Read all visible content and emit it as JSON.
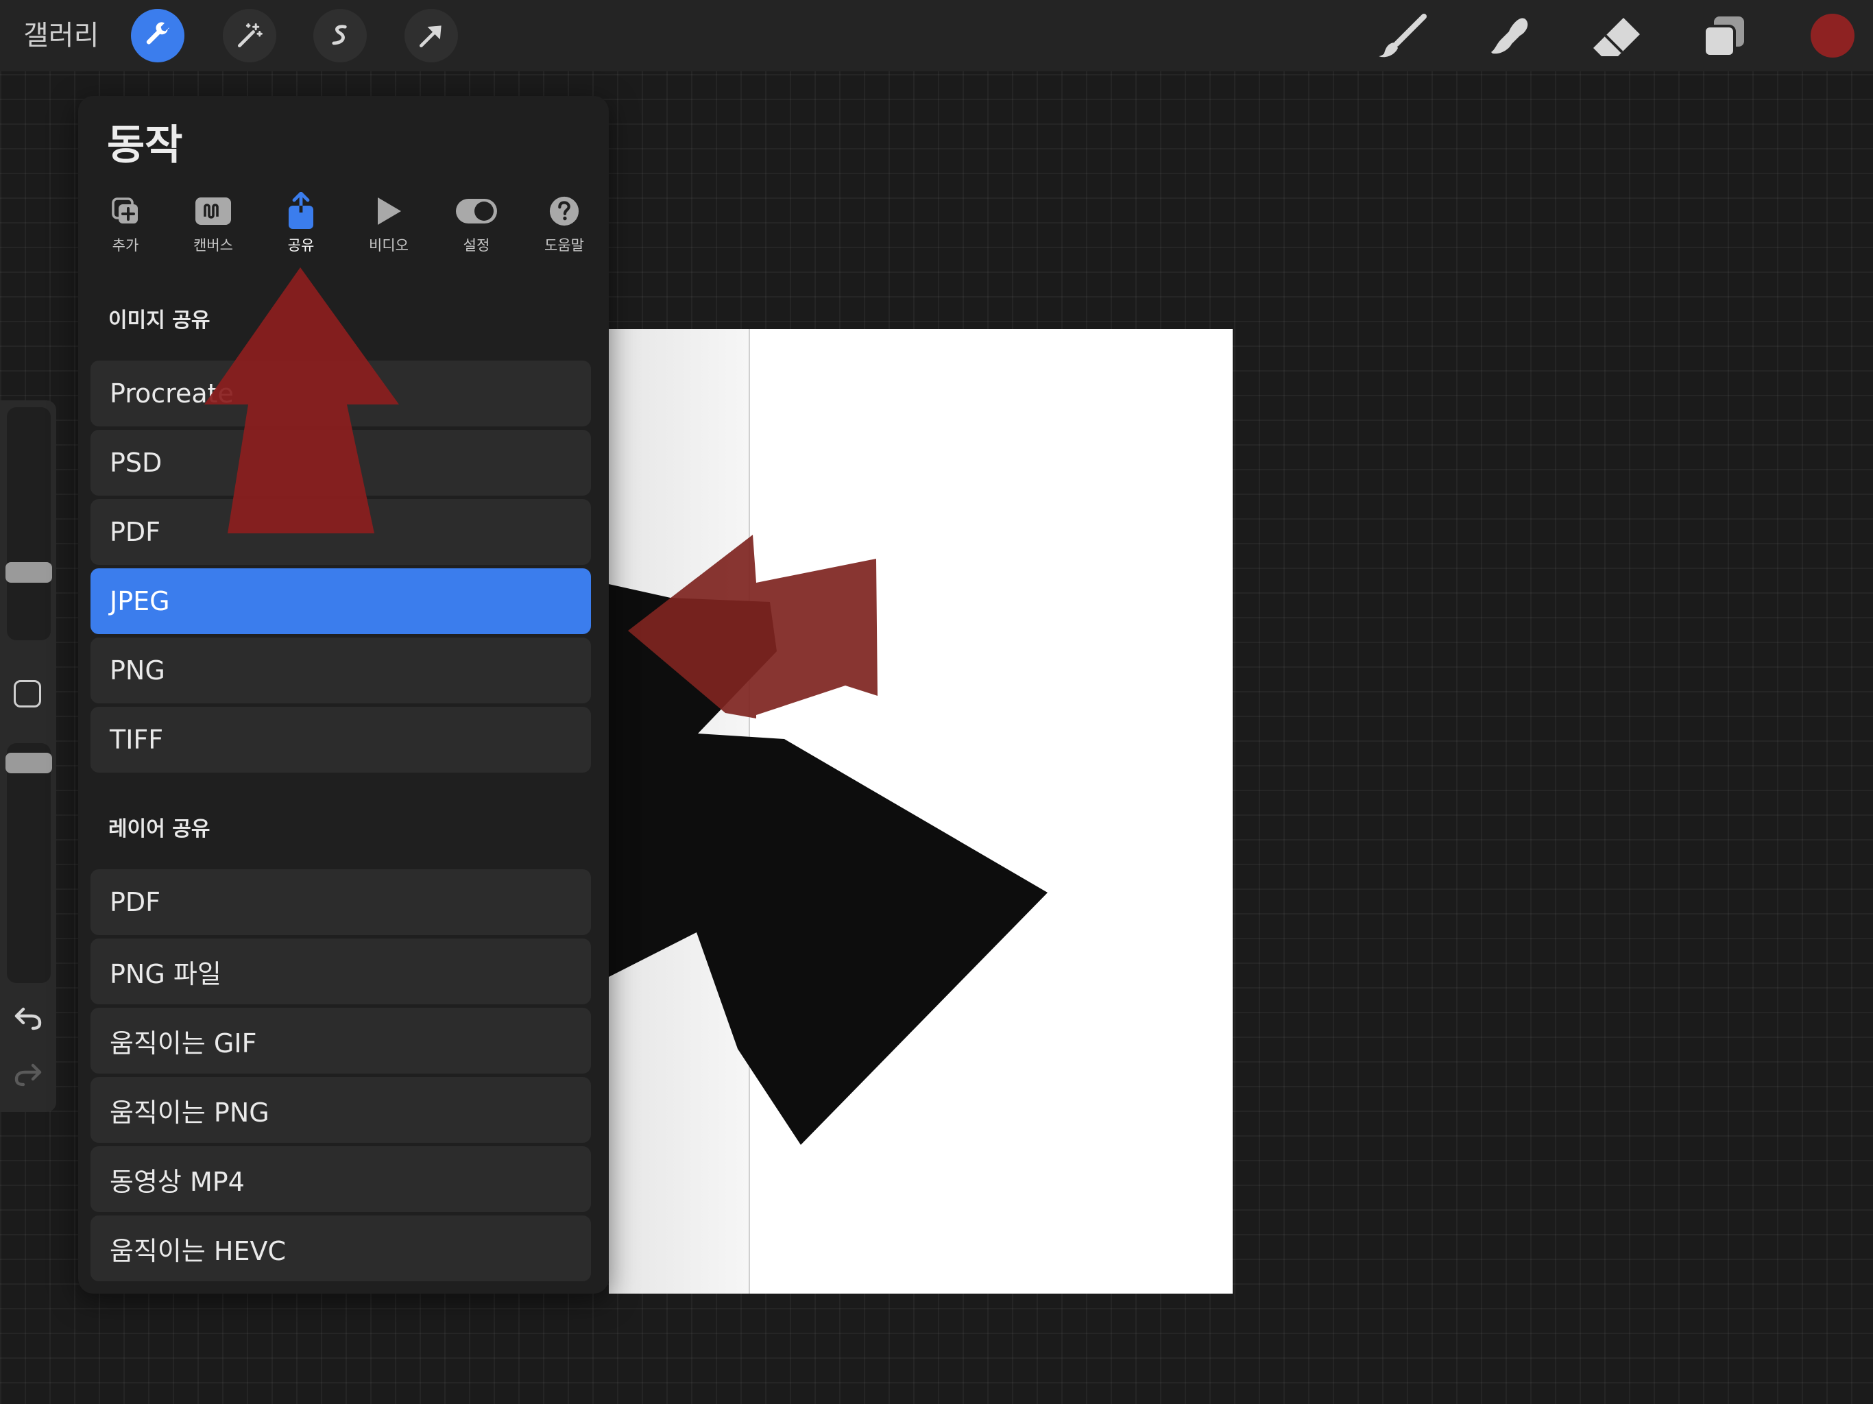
{
  "topbar": {
    "gallery_label": "갤러리",
    "left_tools": [
      "wrench-icon",
      "magic-wand-icon",
      "selection-s-icon",
      "move-arrow-icon"
    ],
    "right_tools": [
      "brush-icon",
      "smudge-icon",
      "eraser-icon",
      "layers-icon"
    ],
    "color_swatch": "#8e2222",
    "accent": "#3b7ded"
  },
  "panel": {
    "title": "동작",
    "tabs": [
      {
        "label": "추가",
        "icon": "add-icon"
      },
      {
        "label": "캔버스",
        "icon": "canvas-icon"
      },
      {
        "label": "공유",
        "icon": "share-icon",
        "active": true
      },
      {
        "label": "비디오",
        "icon": "play-icon"
      },
      {
        "label": "설정",
        "icon": "toggle-icon"
      },
      {
        "label": "도움말",
        "icon": "help-icon"
      }
    ],
    "image_share": {
      "heading": "이미지 공유",
      "items": [
        "Procreate",
        "PSD",
        "PDF",
        "JPEG",
        "PNG",
        "TIFF"
      ],
      "selected": "JPEG"
    },
    "layer_share": {
      "heading": "레이어 공유",
      "items": [
        "PDF",
        "PNG 파일",
        "움직이는 GIF",
        "움직이는 PNG",
        "동영상 MP4",
        "움직이는 HEVC"
      ]
    }
  },
  "annotation_color": "#8b1e1e"
}
